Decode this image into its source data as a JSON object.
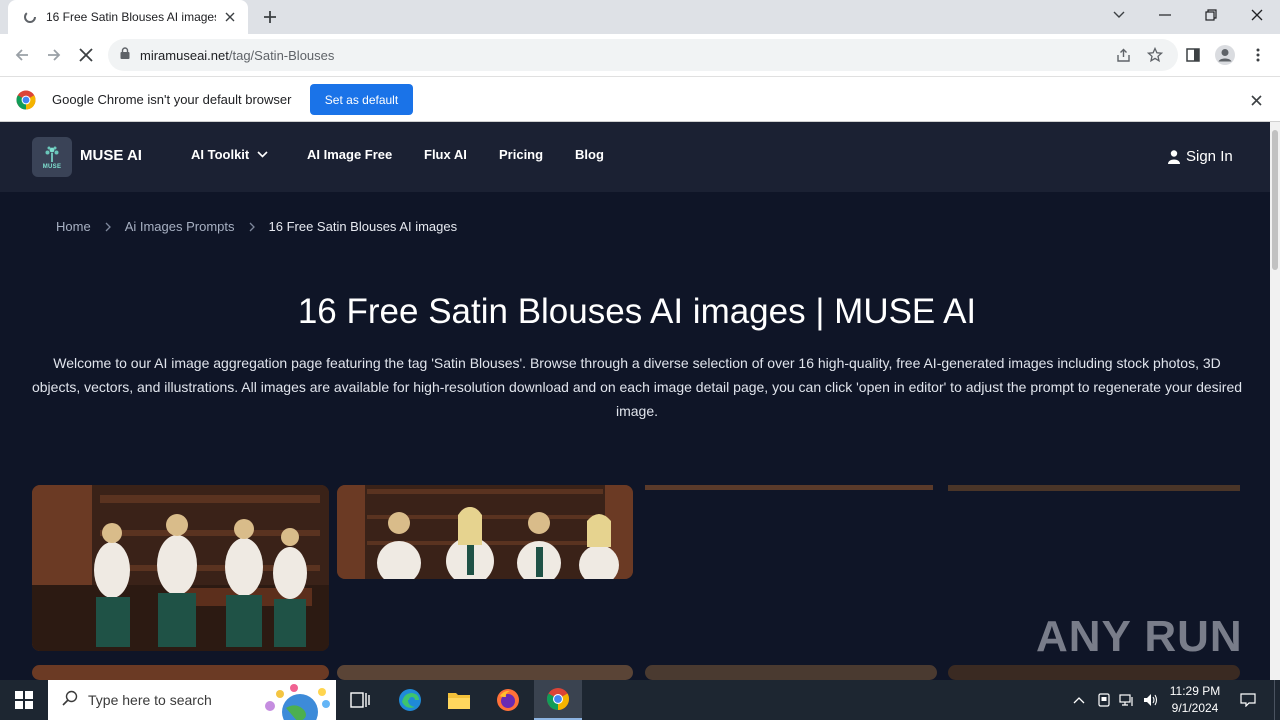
{
  "browser": {
    "tab_title": "16 Free Satin Blouses AI images |",
    "url_host": "miramuseai.net",
    "url_path": "/tag/Satin-Blouses"
  },
  "infobar": {
    "message": "Google Chrome isn't your default browser",
    "button_label": "Set as default"
  },
  "site_nav": {
    "brand": "MUSE AI",
    "logo_text": "MUSE",
    "items": [
      {
        "label": "AI Toolkit"
      },
      {
        "label": "AI Image Free"
      },
      {
        "label": "Flux AI"
      },
      {
        "label": "Pricing"
      },
      {
        "label": "Blog"
      }
    ],
    "signin_label": "Sign In"
  },
  "breadcrumb": {
    "home": "Home",
    "section": "Ai Images Prompts",
    "current": "16 Free Satin Blouses AI images"
  },
  "main": {
    "title": "16 Free Satin Blouses AI images | MUSE AI",
    "description": "Welcome to our AI image aggregation page featuring the tag 'Satin Blouses'. Browse through a diverse selection of over 16 high-quality, free AI-generated images including stock photos, 3D objects, vectors, and illustrations. All images are available for high-resolution download and on each image detail page, you can click 'open in editor' to adjust the prompt to regenerate your desired image."
  },
  "watermark": "ANY RUN",
  "taskbar": {
    "search_placeholder": "Type here to search",
    "time": "11:29 PM",
    "date": "9/1/2024"
  },
  "colors": {
    "page_bg": "#0f1527",
    "nav_bg": "#1b2133",
    "accent_blue": "#1a73e8",
    "taskbar_bg": "#1d2631"
  }
}
